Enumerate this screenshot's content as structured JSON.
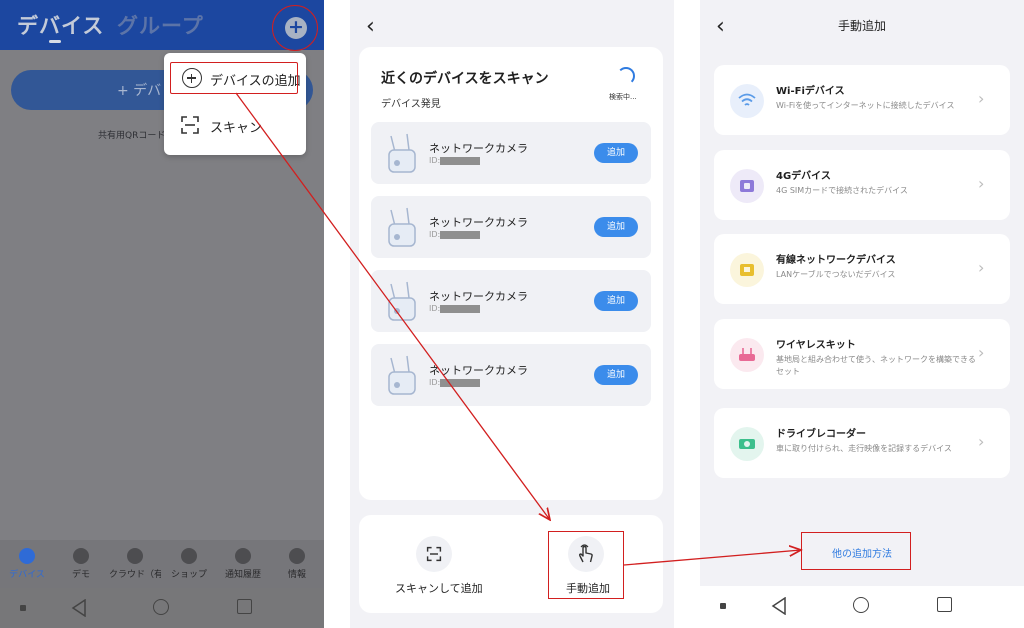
{
  "panel1": {
    "tabs": [
      {
        "label": "デバイス",
        "active": true
      },
      {
        "label": "グループ",
        "active": false
      }
    ],
    "add_button_label": "+ デバ",
    "qr_hint": "共有用QRコードを",
    "menu": {
      "items": [
        {
          "label": "デバイスの追加",
          "icon": "circle-plus-icon"
        },
        {
          "label": "スキャン",
          "icon": "scan-icon"
        }
      ]
    },
    "bottom_nav": [
      {
        "label": "デバイス",
        "icon": "device-icon",
        "active": true
      },
      {
        "label": "デモ",
        "icon": "demo-icon",
        "active": false
      },
      {
        "label": "クラウド（有",
        "icon": "cloud-icon",
        "active": false
      },
      {
        "label": "ショップ",
        "icon": "cart-icon",
        "active": false
      },
      {
        "label": "通知履歴",
        "icon": "message-icon",
        "active": false
      },
      {
        "label": "情報",
        "icon": "person-icon",
        "active": false
      }
    ]
  },
  "panel2": {
    "scan_title": "近くのデバイスをスキャン",
    "found_label": "デバイス発見",
    "searching": "検索中...",
    "devices": [
      {
        "name": "ネットワークカメラ",
        "id_prefix": "ID:",
        "add_label": "追加"
      },
      {
        "name": "ネットワークカメラ",
        "id_prefix": "ID:",
        "add_label": "追加"
      },
      {
        "name": "ネットワークカメラ",
        "id_prefix": "ID:",
        "add_label": "追加"
      },
      {
        "name": "ネットワークカメラ",
        "id_prefix": "ID:",
        "add_label": "追加"
      }
    ],
    "actions": [
      {
        "label": "スキャンして追加",
        "icon": "scan-icon"
      },
      {
        "label": "手動追加",
        "icon": "hand-tap-icon"
      }
    ]
  },
  "panel3": {
    "title": "手動追加",
    "categories": [
      {
        "name": "Wi-Fiデバイス",
        "desc": "Wi-Fiを使ってインターネットに接続したデバイス",
        "icon": "wifi-icon",
        "color": "#e8effb",
        "accent": "#5a9be8"
      },
      {
        "name": "4Gデバイス",
        "desc": "4G SIMカードで接続されたデバイス",
        "icon": "sim-card-icon",
        "color": "#eeeaf8",
        "accent": "#8d79d9"
      },
      {
        "name": "有線ネットワークデバイス",
        "desc": "LANケーブルでつないだデバイス",
        "icon": "lan-icon",
        "color": "#fbf5dc",
        "accent": "#e8be2e"
      },
      {
        "name": "ワイヤレスキット",
        "desc": "基地局と組み合わせて使う、ネットワークを構築できるセット",
        "icon": "router-icon",
        "color": "#fbe9ef",
        "accent": "#e86a95"
      },
      {
        "name": "ドライブレコーダー",
        "desc": "車に取り付けられ、走行映像を記録するデバイス",
        "icon": "dashcam-icon",
        "color": "#e3f5ee",
        "accent": "#3cbf8c"
      }
    ],
    "other_link": "他の追加方法"
  },
  "colors": {
    "annotation_red": "#d21f1f",
    "accent_blue": "#3b8ceb",
    "header_blue": "#1c47a0"
  }
}
